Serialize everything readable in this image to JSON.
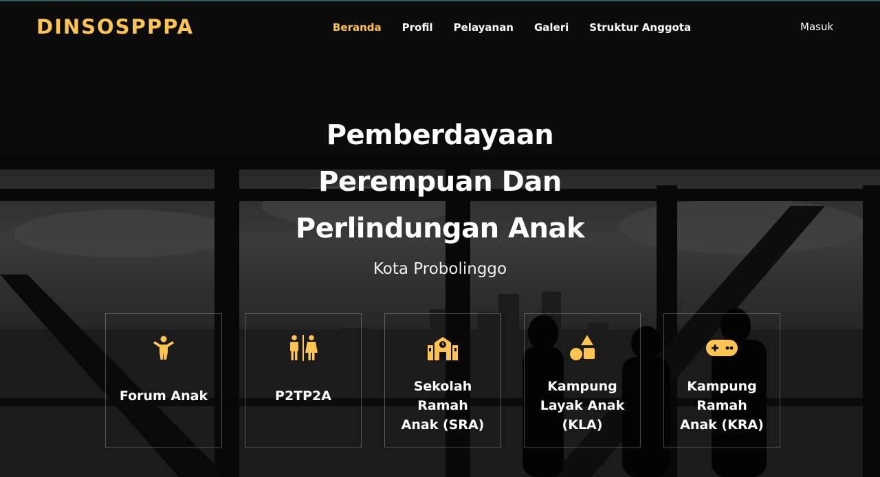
{
  "brand": {
    "logo_text": "DINSOSPPPA",
    "accent_color": "#ffc451"
  },
  "nav": {
    "items": [
      {
        "label": "Beranda",
        "active": true
      },
      {
        "label": "Profil",
        "active": false
      },
      {
        "label": "Pelayanan",
        "active": false
      },
      {
        "label": "Galeri",
        "active": false
      },
      {
        "label": "Struktur Anggota",
        "active": false
      }
    ],
    "login_label": "Masuk"
  },
  "hero": {
    "title_lines": [
      "Pemberdayaan",
      "Perempuan Dan",
      "Perlindungan Anak"
    ],
    "subtitle": "Kota Probolinggo"
  },
  "cards": [
    {
      "icon": "child-icon",
      "title_lines": [
        "Forum Anak"
      ]
    },
    {
      "icon": "restroom-icon",
      "title_lines": [
        "P2TP2A"
      ]
    },
    {
      "icon": "school-icon",
      "title_lines": [
        "Sekolah",
        "Ramah",
        "Anak (SRA)"
      ]
    },
    {
      "icon": "shapes-icon",
      "title_lines": [
        "Kampung",
        "Layak Anak",
        "(KLA)"
      ]
    },
    {
      "icon": "gamepad-icon",
      "title_lines": [
        "Kampung",
        "Ramah",
        "Anak (KRA)"
      ]
    }
  ]
}
